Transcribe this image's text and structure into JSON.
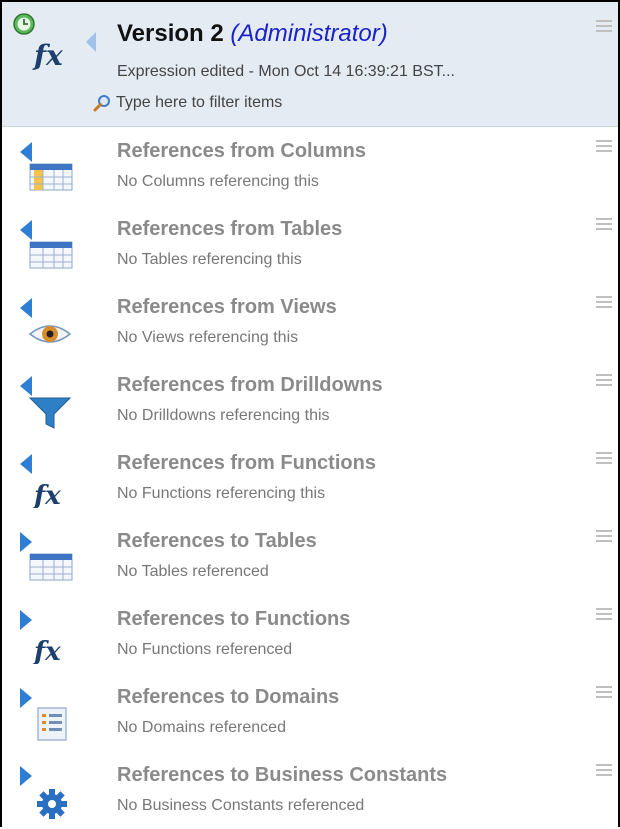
{
  "header": {
    "title": "Version 2",
    "role": "(Administrator)",
    "subtitle": "Expression edited  - Mon Oct 14 16:39:21 BST...",
    "filter_placeholder": "Type here to filter items",
    "icon": "function-clock-icon"
  },
  "colors": {
    "header_bg": "#e4ebf3",
    "admin_text": "#1a22c8",
    "arrow": "#2e7fd4",
    "row_title": "#8a8a8a"
  },
  "items": [
    {
      "title": "References from Columns",
      "subtitle": "No Columns referencing this",
      "icon": "column-table-icon",
      "direction": "from"
    },
    {
      "title": "References from Tables",
      "subtitle": "No Tables referencing this",
      "icon": "table-icon",
      "direction": "from"
    },
    {
      "title": "References from Views",
      "subtitle": "No Views referencing this",
      "icon": "eye-icon",
      "direction": "from"
    },
    {
      "title": "References from Drilldowns",
      "subtitle": "No Drilldowns referencing this",
      "icon": "funnel-icon",
      "direction": "from"
    },
    {
      "title": "References from Functions",
      "subtitle": "No Functions referencing this",
      "icon": "function-icon",
      "direction": "from"
    },
    {
      "title": "References to Tables",
      "subtitle": "No Tables referenced",
      "icon": "table-icon",
      "direction": "to"
    },
    {
      "title": "References to Functions",
      "subtitle": "No Functions referenced",
      "icon": "function-icon",
      "direction": "to"
    },
    {
      "title": "References to Domains",
      "subtitle": "No Domains referenced",
      "icon": "list-icon",
      "direction": "to"
    },
    {
      "title": "References to Business Constants",
      "subtitle": "No Business Constants referenced",
      "icon": "gear-icon",
      "direction": "to"
    }
  ]
}
